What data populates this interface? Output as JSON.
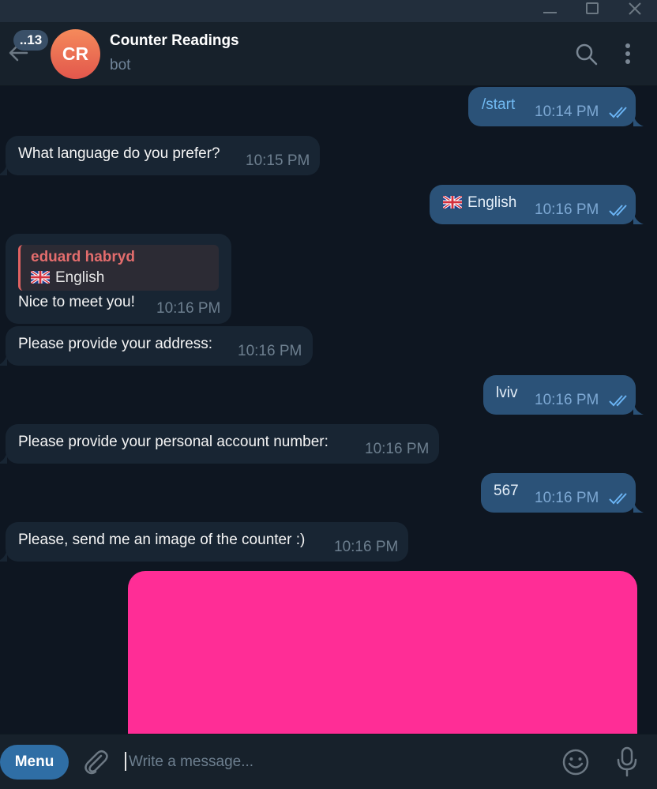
{
  "window": {
    "controls": [
      "minimize-icon",
      "maximize-icon",
      "close-icon"
    ]
  },
  "header": {
    "unread_count": "..13",
    "avatar_initials": "CR",
    "title": "Counter Readings",
    "subtitle": "bot",
    "icons": [
      "back-arrow-icon",
      "search-icon",
      "more-vertical-icon"
    ]
  },
  "messages": [
    {
      "dir": "out",
      "text": "/start",
      "time": "10:14 PM",
      "read": true
    },
    {
      "dir": "in",
      "text": "What language do you prefer?",
      "time": "10:15 PM"
    },
    {
      "dir": "out",
      "text": "English",
      "flag": "uk-flag-icon",
      "time": "10:16 PM",
      "read": true
    },
    {
      "dir": "in",
      "reply": {
        "name": "eduard habryd",
        "text": "English",
        "flag": "uk-flag-icon"
      },
      "text": "Nice to meet you!",
      "time": "10:16 PM"
    },
    {
      "dir": "in",
      "text": "Please provide your address:",
      "time": "10:16 PM"
    },
    {
      "dir": "out",
      "text": "lviv",
      "time": "10:16 PM",
      "read": true
    },
    {
      "dir": "in",
      "text": "Please provide your personal account number:",
      "time": "10:16 PM"
    },
    {
      "dir": "out",
      "text": "567",
      "time": "10:16 PM",
      "read": true
    },
    {
      "dir": "in",
      "text": "Please, send me an image of the counter :)",
      "time": "10:16 PM"
    }
  ],
  "image_message": {
    "color": "#ff2d96"
  },
  "composer": {
    "menu_label": "Menu",
    "placeholder": "Write a message...",
    "icons": [
      "paperclip-icon",
      "emoji-icon",
      "microphone-icon"
    ]
  },
  "colors": {
    "background": "#0e1621",
    "header": "#17212b",
    "incoming_bubble": "#182533",
    "outgoing_bubble": "#2b5278",
    "accent": "#2f6ea5",
    "avatar": "#e2574c"
  }
}
